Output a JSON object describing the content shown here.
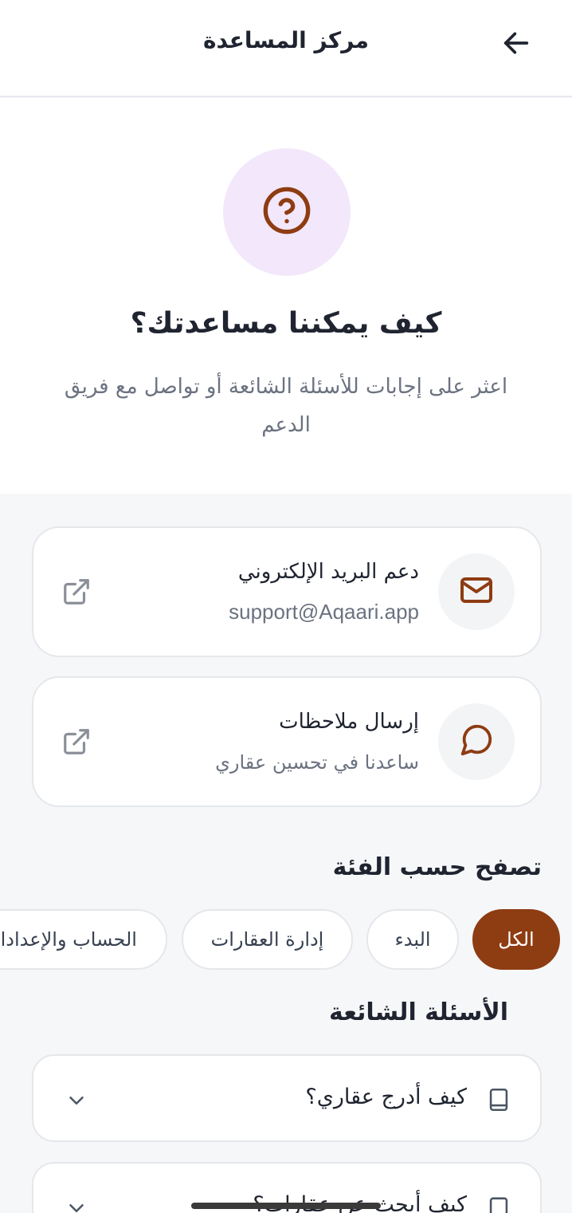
{
  "header": {
    "title": "مركز المساعدة",
    "back_icon": "arrow-left-icon"
  },
  "hero": {
    "icon": "help-circle-icon",
    "title": "كيف يمكننا مساعدتك؟",
    "subtitle": "اعثر على إجابات للأسئلة الشائعة أو تواصل مع فريق الدعم"
  },
  "contact": [
    {
      "icon": "mail-icon",
      "title": "دعم البريد الإلكتروني",
      "subtitle": "support@Aqaari.app",
      "action_icon": "external-link-icon"
    },
    {
      "icon": "message-circle-icon",
      "title": "إرسال ملاحظات",
      "subtitle": "ساعدنا في تحسين عقاري",
      "action_icon": "external-link-icon"
    }
  ],
  "categories": {
    "heading": "تصفح حسب الفئة",
    "items": [
      "الكل",
      "البدء",
      "إدارة العقارات",
      "الحساب والإعدادات"
    ],
    "active_index": 0
  },
  "faq": {
    "heading": "الأسئلة الشائعة",
    "items": [
      {
        "icon": "book-icon",
        "question": "كيف أدرج عقاري؟"
      },
      {
        "icon": "square-icon",
        "question": "كيف أبحث عن عقارات؟"
      }
    ]
  },
  "colors": {
    "accent": "#8e3c12",
    "hero_circle": "#f3e7fb",
    "background": "#f6f7f9",
    "card_border": "#e5e7eb",
    "muted_text": "#6b7280"
  }
}
